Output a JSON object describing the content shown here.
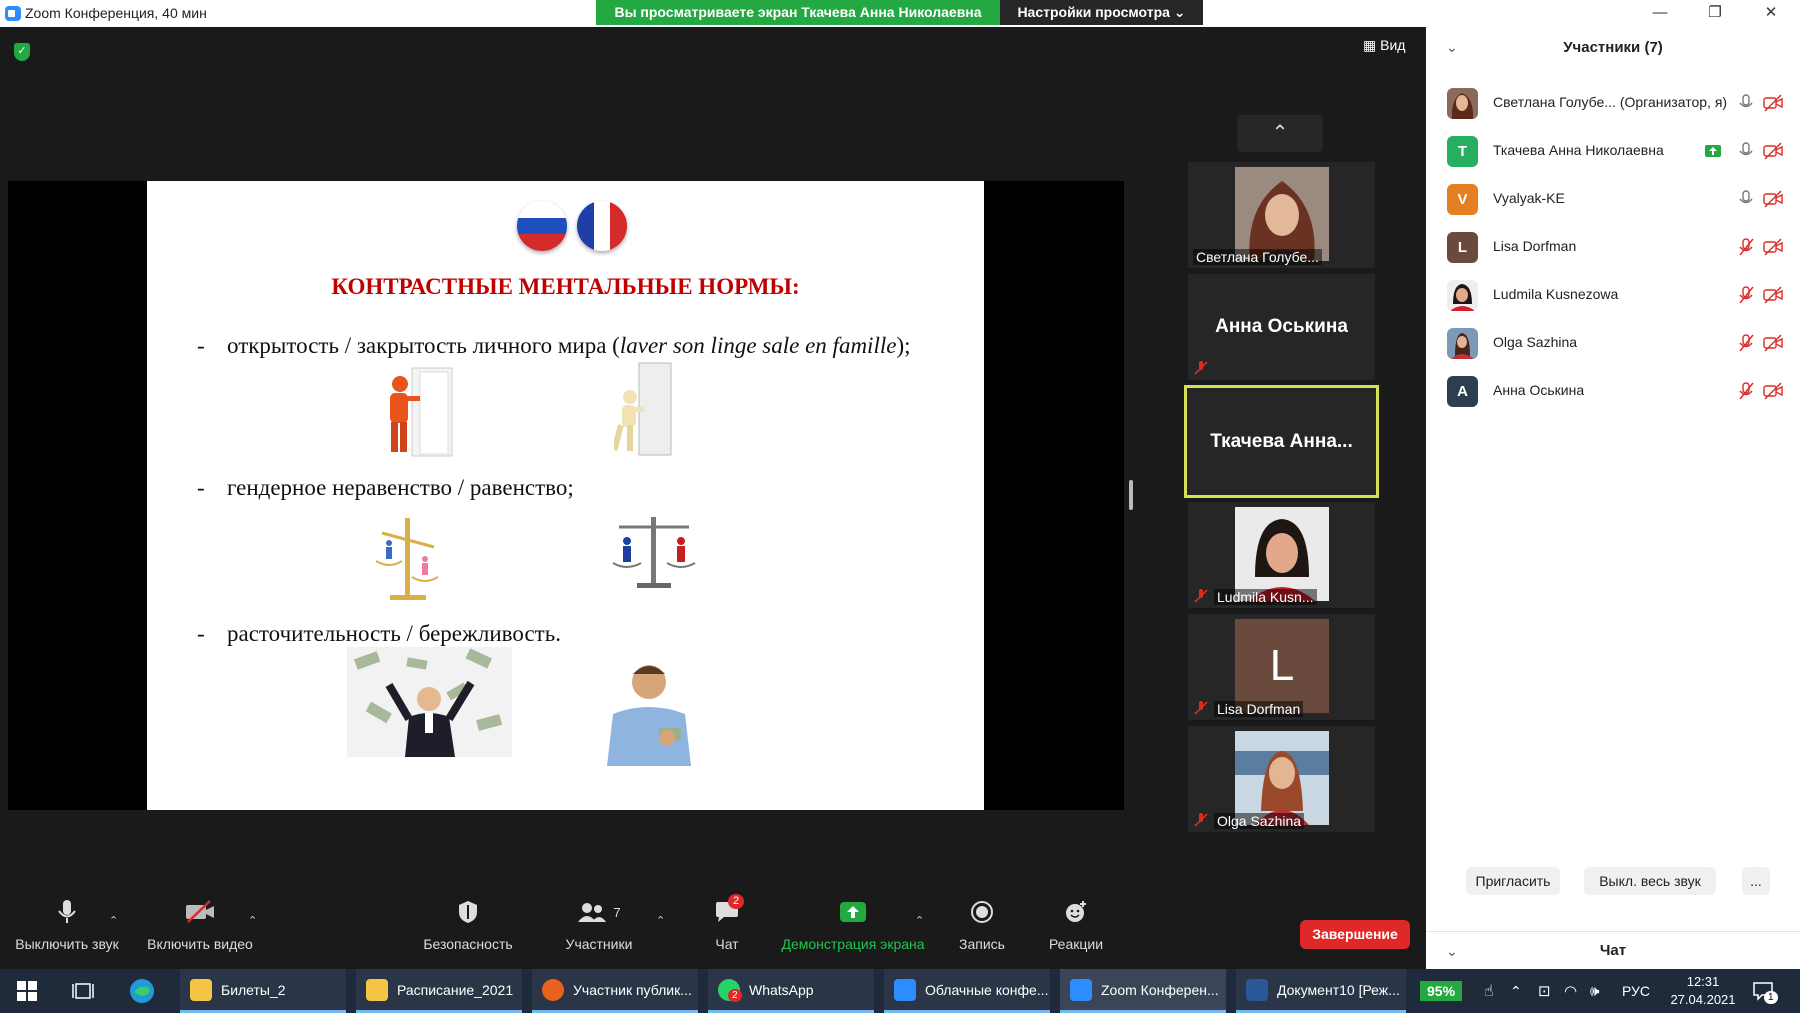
{
  "window": {
    "title": "Zoom Конференция, 40 мин"
  },
  "banner": {
    "viewing": "Вы просматриваете экран Ткачева Анна Николаевна",
    "settings": "Настройки просмотра ⌄"
  },
  "view_button": "Вид",
  "slide": {
    "title": "КОНТРАСТНЫЕ МЕНТАЛЬНЫЕ НОРМЫ:",
    "dash": "-",
    "b1_pre": "открытость / закрытость личного мира (",
    "b1_italic": "laver son linge sale en famille",
    "b1_post": ");",
    "b2": "гендерное неравенство / равенство;",
    "b3": "расточительность / бережливость."
  },
  "gallery": {
    "tiles": [
      {
        "name": "Светлана Голубе...",
        "muted": false
      },
      {
        "name": "Анна Оськина",
        "muted": true
      },
      {
        "name": "Ткачева  Анна...",
        "muted": false,
        "active": true
      },
      {
        "name": "Ludmila Kusn...",
        "muted": true
      },
      {
        "name": "Lisa Dorfman",
        "muted": true,
        "avatar_letter": "L"
      },
      {
        "name": "Olga Sazhina",
        "muted": true
      }
    ]
  },
  "toolbar": {
    "mute": "Выключить звук",
    "video": "Включить видео",
    "security": "Безопасность",
    "participants": "Участники",
    "participants_count": "7",
    "chat": "Чат",
    "chat_badge": "2",
    "share": "Демонстрация экрана",
    "record": "Запись",
    "reactions": "Реакции",
    "end": "Завершение"
  },
  "panel": {
    "title": "Участники (7)",
    "participants": [
      {
        "name": "Светлана Голубе... (Организатор, я)",
        "avatar": "photo",
        "color": "#7a4a3a",
        "mic": "on"
      },
      {
        "name": "Ткачева Анна Николаевна",
        "avatar": "T",
        "color": "#27ae60",
        "mic": "on",
        "sharing": true
      },
      {
        "name": "Vyalyak-KE",
        "avatar": "V",
        "color": "#e67e22",
        "mic": "on"
      },
      {
        "name": "Lisa Dorfman",
        "avatar": "L",
        "color": "#6b4a3e",
        "mic": "off"
      },
      {
        "name": "Ludmila Kusnezowa",
        "avatar": "photo",
        "color": "#8a5a4a",
        "mic": "off"
      },
      {
        "name": "Olga Sazhina",
        "avatar": "photo",
        "color": "#5a3a30",
        "mic": "off"
      },
      {
        "name": "Анна Оськина",
        "avatar": "A",
        "color": "#2c3e50",
        "mic": "off"
      }
    ],
    "invite": "Пригласить",
    "mute_all": "Выкл. весь звук",
    "more": "...",
    "chat": "Чат"
  },
  "taskbar": {
    "items": [
      "Билеты_2",
      "Расписание_2021",
      "Участник публик...",
      "WhatsApp",
      "Облачные конфе...",
      "Zoom Конферен...",
      "Документ10 [Реж..."
    ],
    "whatsapp_badge": "2",
    "battery": "95%",
    "lang": "РУС",
    "time": "12:31",
    "date": "27.04.2021",
    "notif": "1"
  }
}
